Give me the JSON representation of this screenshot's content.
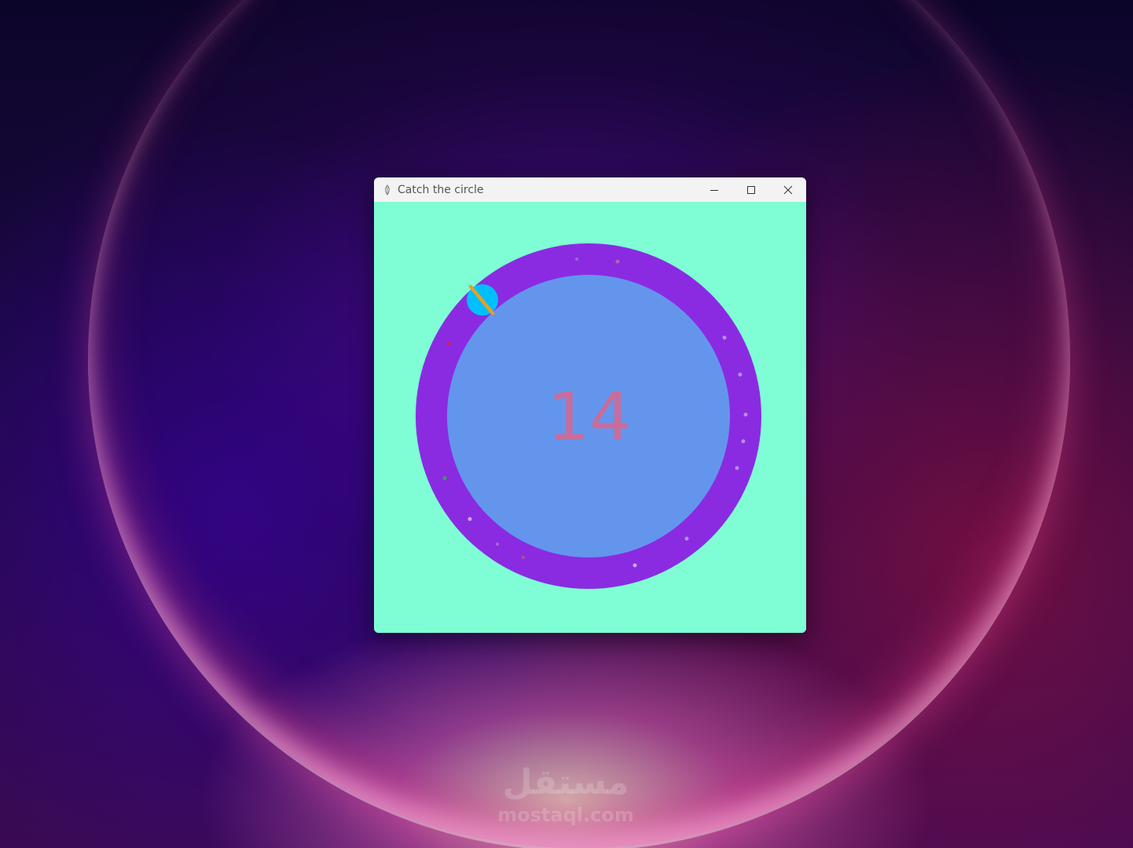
{
  "window": {
    "title": "Catch the circle",
    "icon": "feather-icon",
    "buttons": {
      "minimize_icon": "minimize-icon",
      "maximize_icon": "maximize-icon",
      "close_icon": "close-icon"
    }
  },
  "game": {
    "score": "14",
    "colors": {
      "background": "#7ffed6",
      "ring": "#8a2be2",
      "inner_disc": "#6495ed",
      "target_ball": "#00bfff",
      "paddle": "#e8a020",
      "score_text": "#c86d9b"
    }
  },
  "watermark": {
    "arabic": "مستقل",
    "latin": "mostaql.com"
  }
}
